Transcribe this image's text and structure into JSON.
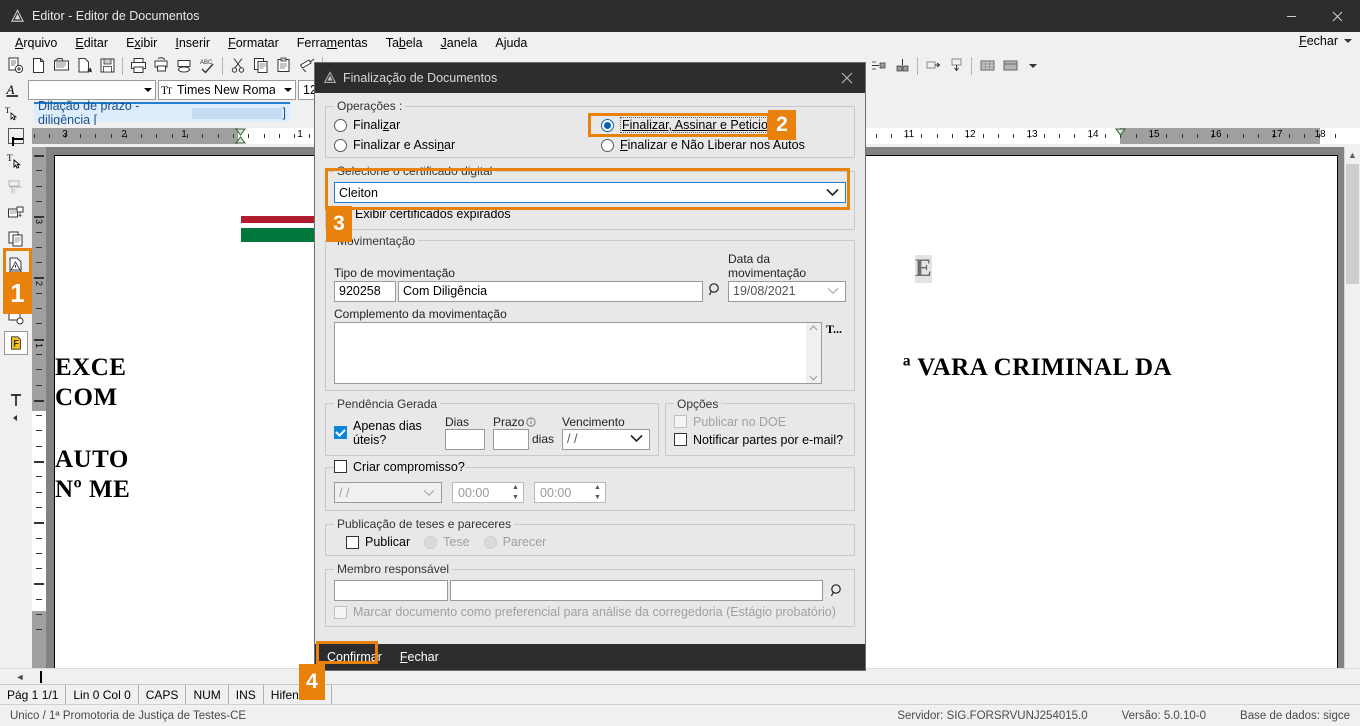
{
  "window": {
    "title": "Editor - Editor de Documentos",
    "minimize": "—",
    "close": "✕"
  },
  "menu": {
    "items": [
      "Arquivo",
      "Editar",
      "Exibir",
      "Inserir",
      "Formatar",
      "Ferramentas",
      "Tabela",
      "Janela",
      "Ajuda"
    ],
    "right_label": "Fechar"
  },
  "format_bar": {
    "style_value": "",
    "font_name": "Times New Roman",
    "font_size": "12"
  },
  "style_bar": {
    "text": "Dilação de prazo - diligência ["
  },
  "ruler": {
    "left_numbers": [
      "3",
      "2",
      "1"
    ],
    "right_numbers": [
      "1",
      "11",
      "12",
      "13",
      "14",
      "15",
      "16",
      "17",
      "18"
    ]
  },
  "document": {
    "line1": "EXCE",
    "line2": "COM",
    "line3": "AUTO",
    "line4": "Nº ME",
    "right_fragment": "E",
    "right_line": "ª VARA CRIMINAL DA"
  },
  "status_bar": {
    "cells": [
      "Pág 1   1/1",
      "Lin 0  Col 0",
      "CAPS",
      "NUM",
      "INS",
      "Hifeniza..."
    ]
  },
  "footer": {
    "left": "Unico / 1ª Promotoria de Justiça de Testes-CE",
    "server": "Servidor: SIG.FORSRVUNJ254015.0",
    "version": "Versão: 5.0.10-0",
    "database": "Base de dados: sigce"
  },
  "dialog": {
    "title": "Finalização de Documentos",
    "operations": {
      "legend": "Operações :",
      "options": [
        {
          "label": "Finalizar",
          "selected": false
        },
        {
          "label": "Finalizar, Assinar e Peticionar",
          "selected": true
        },
        {
          "label": "Finalizar e Assinar",
          "selected": false
        },
        {
          "label": "Finalizar e Não Liberar nos Autos",
          "selected": false
        }
      ]
    },
    "certificate": {
      "legend": "Selecione o certificado digital",
      "value": "Cleiton",
      "show_expired_label": "Exibir certificados expirados",
      "show_expired_checked": false
    },
    "movement": {
      "legend": "Movimentação",
      "type_label": "Tipo de movimentação",
      "type_code": "920258",
      "type_name": "Com Diligência",
      "date_label": "Data da movimentação",
      "date_value": "19/08/2021",
      "complement_label": "Complemento da movimentação",
      "complement_value": "",
      "side_label": "T..."
    },
    "pending": {
      "legend": "Pendência Gerada",
      "business_days_label": "Apenas dias úteis?",
      "business_days_checked": true,
      "days_label": "Dias",
      "days_value": "",
      "term_label": "Prazo",
      "term_value": "",
      "term_unit": "dias",
      "due_label": "Vencimento",
      "due_value": "/ /"
    },
    "options": {
      "legend": "Opções",
      "publish_doe_label": "Publicar no DOE",
      "publish_doe_checked": false,
      "notify_email_label": "Notificar partes por e-mail?",
      "notify_email_checked": false
    },
    "appointment": {
      "label": "Criar compromisso?",
      "checked": false,
      "date_value": "/ /",
      "time_start": "00:00",
      "time_end": "00:00"
    },
    "publication": {
      "legend": "Publicação de teses e pareceres",
      "publish_label": "Publicar",
      "publish_checked": false,
      "thesis_label": "Tese",
      "opinion_label": "Parecer"
    },
    "member": {
      "legend": "Membro responsável",
      "code_value": "",
      "name_value": "",
      "preferential_label": "Marcar documento como preferencial para análise da corregedoria (Estágio probatório)",
      "preferential_checked": false
    },
    "footer_buttons": {
      "confirm": "Confirmar",
      "close": "Fechar"
    }
  },
  "annotations": {
    "accent_color": "#e8820c",
    "badges": [
      "1",
      "2",
      "3",
      "4"
    ]
  }
}
